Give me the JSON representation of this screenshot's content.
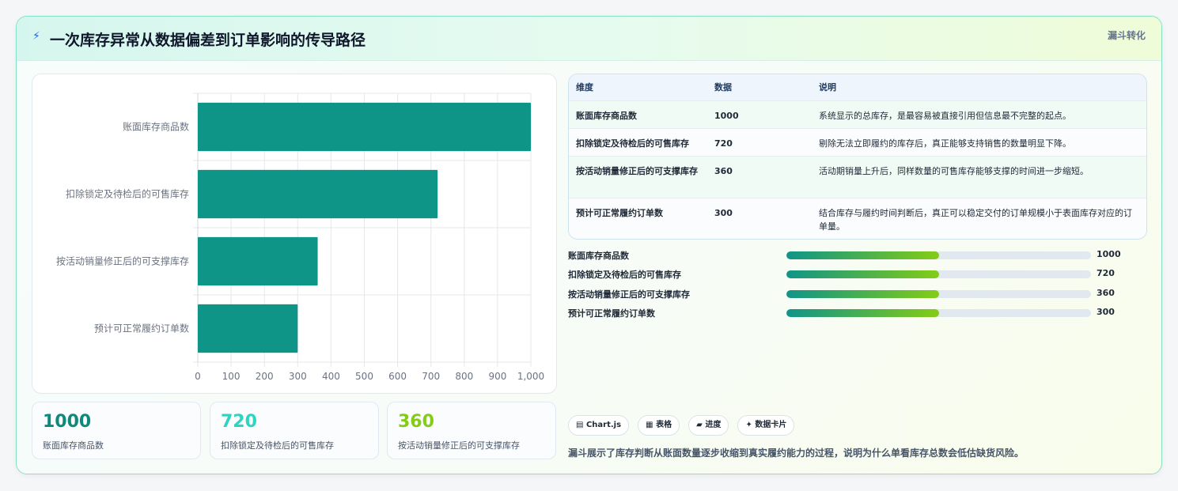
{
  "header": {
    "icon": "bolt-icon",
    "title": "一次库存异常从数据偏差到订单影响的传导路径",
    "tag": "漏斗转化"
  },
  "chart_data": {
    "type": "bar",
    "orientation": "horizontal",
    "categories": [
      "账面库存商品数",
      "扣除锁定及待检后的可售库存",
      "按活动销量修正后的可支撑库存",
      "预计可正常履约订单数"
    ],
    "values": [
      1000,
      720,
      360,
      300
    ],
    "xlim": [
      0,
      1000
    ],
    "xticks": [
      "0",
      "100",
      "200",
      "300",
      "400",
      "500",
      "600",
      "700",
      "800",
      "900",
      "1,000"
    ],
    "grid": true,
    "bar_color": "#0f9488"
  },
  "kpis": [
    {
      "value": "1000",
      "label": "账面库存商品数",
      "color": "#0f8a7a"
    },
    {
      "value": "720",
      "label": "扣除锁定及待检后的可售库存",
      "color": "#2dd4bf"
    },
    {
      "value": "360",
      "label": "按活动销量修正后的可支撑库存",
      "color": "#84cc16"
    }
  ],
  "table": {
    "headers": [
      "维度",
      "数据",
      "说明"
    ],
    "rows": [
      {
        "dim": "账面库存商品数",
        "val": "1000",
        "desc": "系统显示的总库存，是最容易被直接引用但信息最不完整的起点。"
      },
      {
        "dim": "扣除锁定及待检后的可售库存",
        "val": "720",
        "desc": "剔除无法立即履约的库存后，真正能够支持销售的数量明显下降。"
      },
      {
        "dim": "按活动销量修正后的可支撑库存",
        "val": "360",
        "desc": "活动期销量上升后，同样数量的可售库存能够支撑的时间进一步缩短。"
      },
      {
        "dim": "预计可正常履约订单数",
        "val": "300",
        "desc": "结合库存与履约时间判断后，真正可以稳定交付的订单规模小于表面库存对应的订单量。"
      }
    ]
  },
  "progress": [
    {
      "label": "账面库存商品数",
      "value": "1000",
      "fill_pct": 50
    },
    {
      "label": "扣除锁定及待检后的可售库存",
      "value": "720",
      "fill_pct": 50
    },
    {
      "label": "按活动销量修正后的可支撑库存",
      "value": "360",
      "fill_pct": 50
    },
    {
      "label": "预计可正常履约订单数",
      "value": "300",
      "fill_pct": 50
    }
  ],
  "chips": [
    {
      "icon": "▤",
      "label": "Chart.js"
    },
    {
      "icon": "▦",
      "label": "表格"
    },
    {
      "icon": "▰",
      "label": "进度"
    },
    {
      "icon": "✦",
      "label": "数据卡片"
    }
  ],
  "footer": "漏斗展示了库存判断从账面数量逐步收缩到真实履约能力的过程，说明为什么单看库存总数会低估缺货风险。"
}
